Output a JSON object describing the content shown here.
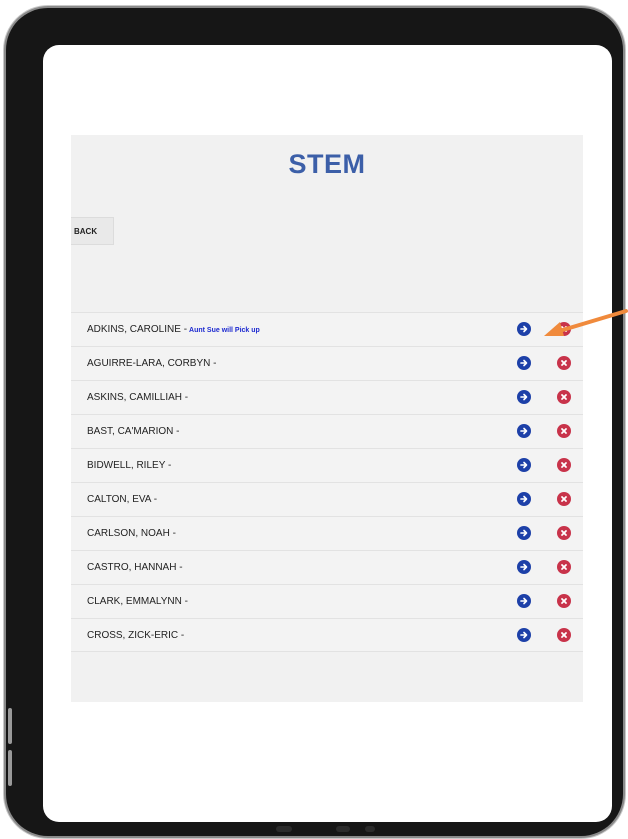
{
  "app": {
    "title": "STEM",
    "back_label": "BACK"
  },
  "students": [
    {
      "name": "ADKINS, CAROLINE -",
      "note": "Aunt Sue will Pick up"
    },
    {
      "name": "AGUIRRE-LARA, CORBYN -",
      "note": ""
    },
    {
      "name": "ASKINS, CAMILLIAH -",
      "note": ""
    },
    {
      "name": "BAST, CA'MARION -",
      "note": ""
    },
    {
      "name": "BIDWELL, RILEY -",
      "note": ""
    },
    {
      "name": "CALTON, EVA -",
      "note": ""
    },
    {
      "name": "CARLSON, NOAH -",
      "note": ""
    },
    {
      "name": "CASTRO, HANNAH -",
      "note": ""
    },
    {
      "name": "CLARK, EMMALYNN -",
      "note": ""
    },
    {
      "name": "CROSS, ZICK-ERIC -",
      "note": ""
    }
  ],
  "icons": {
    "checkin": "arrow-right-circle-icon",
    "remove": "x-circle-icon",
    "annotation": "orange-arrow-icon"
  },
  "colors": {
    "title": "#3c5fa8",
    "note": "#1d2ad0",
    "checkin": "#1d40a8",
    "remove": "#c8334a",
    "annotation_arrow": "#f08a3c"
  }
}
